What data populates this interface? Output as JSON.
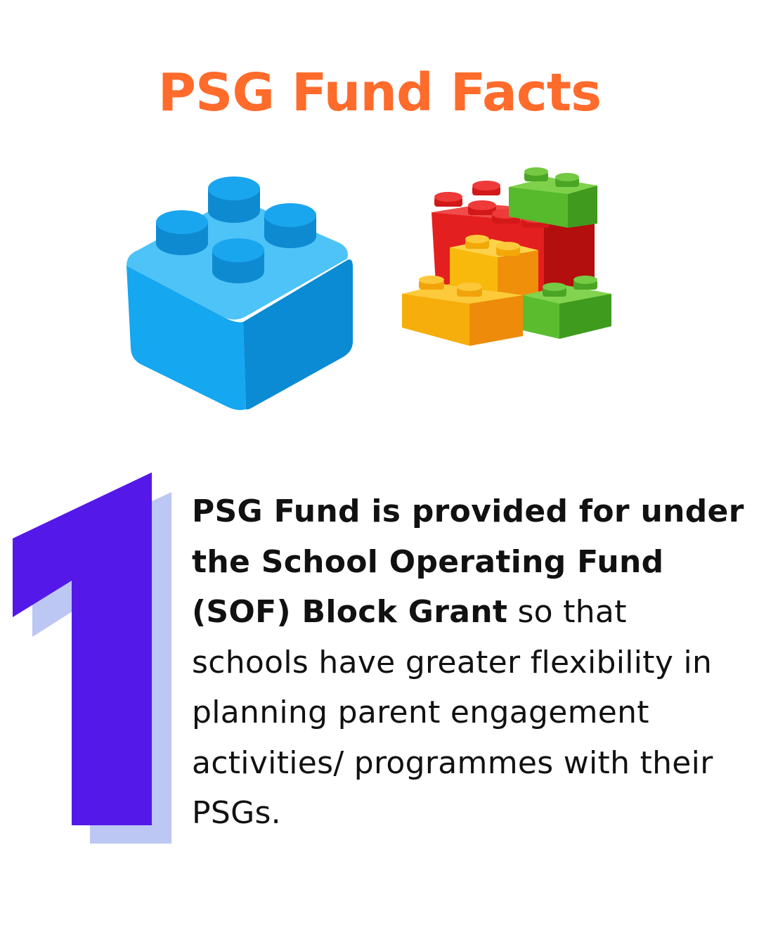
{
  "title": "PSG Fund Facts",
  "colors": {
    "title": "#ff6b2b",
    "number_main": "#5419e8",
    "number_shadow": "#bdc7f4",
    "brick_blue": "#1aa6ef",
    "brick_red": "#e41f1f",
    "brick_yellow": "#f5b20a",
    "brick_green": "#56b82a"
  },
  "illustrations": {
    "left": "blue-lego-brick-icon",
    "right": "lego-bricks-pile-icon"
  },
  "fact": {
    "number": "1",
    "bold_text": "PSG Fund is provided for under the School Operating Fund (SOF) Block Grant",
    "regular_text": " so that schools have greater flexibility in planning parent engagement activities/ programmes with their PSGs."
  }
}
